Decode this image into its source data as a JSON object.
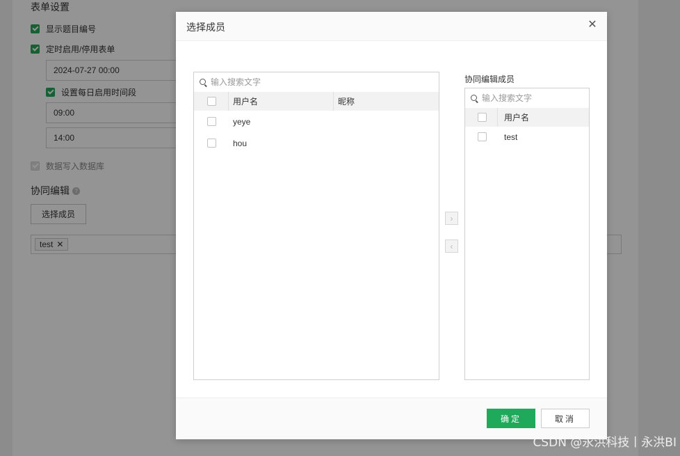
{
  "background": {
    "section_title": "表单设置",
    "show_number_label": "显示题目编号",
    "timed_enable_label": "定时启用/停用表单",
    "datetime_value": "2024-07-27 00:00",
    "daily_period_label": "设置每日启用时间段",
    "start_time": "09:00",
    "end_time": "14:00",
    "write_db_label": "数据写入数据库",
    "collab_title": "协同编辑",
    "help_icon_text": "?",
    "select_members_button": "选择成员",
    "tags": [
      {
        "label": "test"
      }
    ]
  },
  "dialog": {
    "title": "选择成员",
    "close_glyph": "✕",
    "left": {
      "search_placeholder": "输入搜索文字",
      "columns": {
        "username": "用户名",
        "nickname": "昵称"
      },
      "rows": [
        {
          "username": "yeye",
          "nickname": ""
        },
        {
          "username": "hou",
          "nickname": ""
        }
      ]
    },
    "transfer": {
      "to_right": "›",
      "to_left": "‹"
    },
    "right": {
      "label": "协同编辑成员",
      "search_placeholder": "输入搜索文字",
      "columns": {
        "username": "用户名"
      },
      "rows": [
        {
          "username": "test"
        }
      ]
    },
    "footer": {
      "ok": "确定",
      "cancel": "取消"
    }
  },
  "watermark": "CSDN @永洪科技丨永洪BI",
  "colors": {
    "primary": "#1fa95a",
    "checkbox_checked": "#26a65b"
  }
}
